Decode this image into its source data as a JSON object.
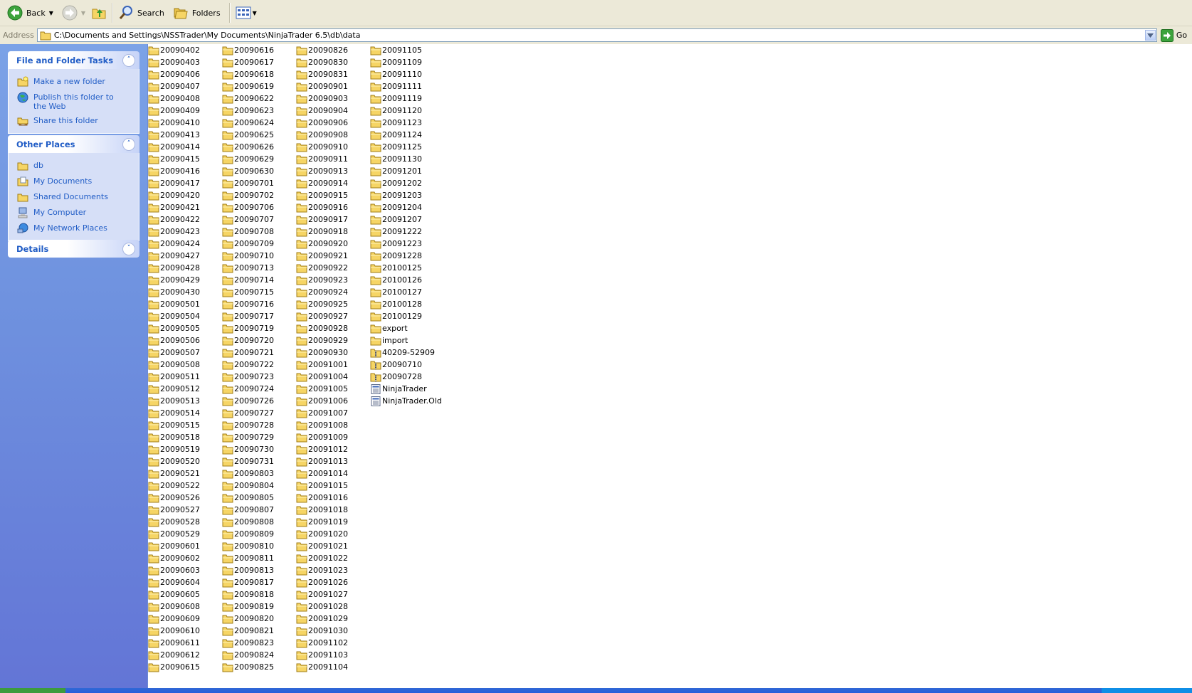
{
  "toolbar": {
    "back_label": "Back",
    "search_label": "Search",
    "folders_label": "Folders"
  },
  "address": {
    "label": "Address",
    "path": "C:\\Documents and Settings\\NSSTrader\\My Documents\\NinjaTrader 6.5\\db\\data",
    "go_label": "Go"
  },
  "tasks": {
    "file_folder": {
      "title": "File and Folder Tasks",
      "items": [
        {
          "label": "Make a new folder",
          "icon": "new-folder-icon"
        },
        {
          "label": "Publish this folder to the Web",
          "icon": "publish-web-icon"
        },
        {
          "label": "Share this folder",
          "icon": "share-folder-icon"
        }
      ]
    },
    "other_places": {
      "title": "Other Places",
      "items": [
        {
          "label": "db",
          "icon": "folder-icon"
        },
        {
          "label": "My Documents",
          "icon": "my-documents-icon"
        },
        {
          "label": "Shared Documents",
          "icon": "folder-icon"
        },
        {
          "label": "My Computer",
          "icon": "my-computer-icon"
        },
        {
          "label": "My Network Places",
          "icon": "network-places-icon"
        }
      ]
    },
    "details": {
      "title": "Details"
    }
  },
  "files": {
    "columns": [
      [
        {
          "name": "20090402",
          "icon": "folder"
        },
        {
          "name": "20090403",
          "icon": "folder"
        },
        {
          "name": "20090406",
          "icon": "folder"
        },
        {
          "name": "20090407",
          "icon": "folder"
        },
        {
          "name": "20090408",
          "icon": "folder"
        },
        {
          "name": "20090409",
          "icon": "folder"
        },
        {
          "name": "20090410",
          "icon": "folder"
        },
        {
          "name": "20090413",
          "icon": "folder"
        },
        {
          "name": "20090414",
          "icon": "folder"
        },
        {
          "name": "20090415",
          "icon": "folder"
        },
        {
          "name": "20090416",
          "icon": "folder"
        },
        {
          "name": "20090417",
          "icon": "folder"
        },
        {
          "name": "20090420",
          "icon": "folder"
        },
        {
          "name": "20090421",
          "icon": "folder"
        },
        {
          "name": "20090422",
          "icon": "folder"
        },
        {
          "name": "20090423",
          "icon": "folder"
        },
        {
          "name": "20090424",
          "icon": "folder"
        },
        {
          "name": "20090427",
          "icon": "folder"
        },
        {
          "name": "20090428",
          "icon": "folder"
        },
        {
          "name": "20090429",
          "icon": "folder"
        },
        {
          "name": "20090430",
          "icon": "folder"
        },
        {
          "name": "20090501",
          "icon": "folder"
        },
        {
          "name": "20090504",
          "icon": "folder"
        },
        {
          "name": "20090505",
          "icon": "folder"
        },
        {
          "name": "20090506",
          "icon": "folder"
        },
        {
          "name": "20090507",
          "icon": "folder"
        },
        {
          "name": "20090508",
          "icon": "folder"
        },
        {
          "name": "20090511",
          "icon": "folder"
        },
        {
          "name": "20090512",
          "icon": "folder"
        },
        {
          "name": "20090513",
          "icon": "folder"
        },
        {
          "name": "20090514",
          "icon": "folder"
        },
        {
          "name": "20090515",
          "icon": "folder"
        },
        {
          "name": "20090518",
          "icon": "folder"
        },
        {
          "name": "20090519",
          "icon": "folder"
        },
        {
          "name": "20090520",
          "icon": "folder"
        },
        {
          "name": "20090521",
          "icon": "folder"
        },
        {
          "name": "20090522",
          "icon": "folder"
        },
        {
          "name": "20090526",
          "icon": "folder"
        },
        {
          "name": "20090527",
          "icon": "folder"
        },
        {
          "name": "20090528",
          "icon": "folder"
        },
        {
          "name": "20090529",
          "icon": "folder"
        },
        {
          "name": "20090601",
          "icon": "folder"
        },
        {
          "name": "20090602",
          "icon": "folder"
        },
        {
          "name": "20090603",
          "icon": "folder"
        },
        {
          "name": "20090604",
          "icon": "folder"
        },
        {
          "name": "20090605",
          "icon": "folder"
        },
        {
          "name": "20090608",
          "icon": "folder"
        },
        {
          "name": "20090609",
          "icon": "folder"
        },
        {
          "name": "20090610",
          "icon": "folder"
        },
        {
          "name": "20090611",
          "icon": "folder"
        },
        {
          "name": "20090612",
          "icon": "folder"
        },
        {
          "name": "20090615",
          "icon": "folder"
        }
      ],
      [
        {
          "name": "20090616",
          "icon": "folder"
        },
        {
          "name": "20090617",
          "icon": "folder"
        },
        {
          "name": "20090618",
          "icon": "folder"
        },
        {
          "name": "20090619",
          "icon": "folder"
        },
        {
          "name": "20090622",
          "icon": "folder"
        },
        {
          "name": "20090623",
          "icon": "folder"
        },
        {
          "name": "20090624",
          "icon": "folder"
        },
        {
          "name": "20090625",
          "icon": "folder"
        },
        {
          "name": "20090626",
          "icon": "folder"
        },
        {
          "name": "20090629",
          "icon": "folder"
        },
        {
          "name": "20090630",
          "icon": "folder"
        },
        {
          "name": "20090701",
          "icon": "folder"
        },
        {
          "name": "20090702",
          "icon": "folder"
        },
        {
          "name": "20090706",
          "icon": "folder"
        },
        {
          "name": "20090707",
          "icon": "folder"
        },
        {
          "name": "20090708",
          "icon": "folder"
        },
        {
          "name": "20090709",
          "icon": "folder"
        },
        {
          "name": "20090710",
          "icon": "folder"
        },
        {
          "name": "20090713",
          "icon": "folder"
        },
        {
          "name": "20090714",
          "icon": "folder"
        },
        {
          "name": "20090715",
          "icon": "folder"
        },
        {
          "name": "20090716",
          "icon": "folder"
        },
        {
          "name": "20090717",
          "icon": "folder"
        },
        {
          "name": "20090719",
          "icon": "folder"
        },
        {
          "name": "20090720",
          "icon": "folder"
        },
        {
          "name": "20090721",
          "icon": "folder"
        },
        {
          "name": "20090722",
          "icon": "folder"
        },
        {
          "name": "20090723",
          "icon": "folder"
        },
        {
          "name": "20090724",
          "icon": "folder"
        },
        {
          "name": "20090726",
          "icon": "folder"
        },
        {
          "name": "20090727",
          "icon": "folder"
        },
        {
          "name": "20090728",
          "icon": "folder"
        },
        {
          "name": "20090729",
          "icon": "folder"
        },
        {
          "name": "20090730",
          "icon": "folder"
        },
        {
          "name": "20090731",
          "icon": "folder"
        },
        {
          "name": "20090803",
          "icon": "folder"
        },
        {
          "name": "20090804",
          "icon": "folder"
        },
        {
          "name": "20090805",
          "icon": "folder"
        },
        {
          "name": "20090807",
          "icon": "folder"
        },
        {
          "name": "20090808",
          "icon": "folder"
        },
        {
          "name": "20090809",
          "icon": "folder"
        },
        {
          "name": "20090810",
          "icon": "folder"
        },
        {
          "name": "20090811",
          "icon": "folder"
        },
        {
          "name": "20090813",
          "icon": "folder"
        },
        {
          "name": "20090817",
          "icon": "folder"
        },
        {
          "name": "20090818",
          "icon": "folder"
        },
        {
          "name": "20090819",
          "icon": "folder"
        },
        {
          "name": "20090820",
          "icon": "folder"
        },
        {
          "name": "20090821",
          "icon": "folder"
        },
        {
          "name": "20090823",
          "icon": "folder"
        },
        {
          "name": "20090824",
          "icon": "folder"
        },
        {
          "name": "20090825",
          "icon": "folder"
        }
      ],
      [
        {
          "name": "20090826",
          "icon": "folder"
        },
        {
          "name": "20090830",
          "icon": "folder"
        },
        {
          "name": "20090831",
          "icon": "folder"
        },
        {
          "name": "20090901",
          "icon": "folder"
        },
        {
          "name": "20090903",
          "icon": "folder"
        },
        {
          "name": "20090904",
          "icon": "folder"
        },
        {
          "name": "20090906",
          "icon": "folder"
        },
        {
          "name": "20090908",
          "icon": "folder"
        },
        {
          "name": "20090910",
          "icon": "folder"
        },
        {
          "name": "20090911",
          "icon": "folder"
        },
        {
          "name": "20090913",
          "icon": "folder"
        },
        {
          "name": "20090914",
          "icon": "folder"
        },
        {
          "name": "20090915",
          "icon": "folder"
        },
        {
          "name": "20090916",
          "icon": "folder"
        },
        {
          "name": "20090917",
          "icon": "folder"
        },
        {
          "name": "20090918",
          "icon": "folder"
        },
        {
          "name": "20090920",
          "icon": "folder"
        },
        {
          "name": "20090921",
          "icon": "folder"
        },
        {
          "name": "20090922",
          "icon": "folder"
        },
        {
          "name": "20090923",
          "icon": "folder"
        },
        {
          "name": "20090924",
          "icon": "folder"
        },
        {
          "name": "20090925",
          "icon": "folder"
        },
        {
          "name": "20090927",
          "icon": "folder"
        },
        {
          "name": "20090928",
          "icon": "folder"
        },
        {
          "name": "20090929",
          "icon": "folder"
        },
        {
          "name": "20090930",
          "icon": "folder"
        },
        {
          "name": "20091001",
          "icon": "folder"
        },
        {
          "name": "20091004",
          "icon": "folder"
        },
        {
          "name": "20091005",
          "icon": "folder"
        },
        {
          "name": "20091006",
          "icon": "folder"
        },
        {
          "name": "20091007",
          "icon": "folder"
        },
        {
          "name": "20091008",
          "icon": "folder"
        },
        {
          "name": "20091009",
          "icon": "folder"
        },
        {
          "name": "20091012",
          "icon": "folder"
        },
        {
          "name": "20091013",
          "icon": "folder"
        },
        {
          "name": "20091014",
          "icon": "folder"
        },
        {
          "name": "20091015",
          "icon": "folder"
        },
        {
          "name": "20091016",
          "icon": "folder"
        },
        {
          "name": "20091018",
          "icon": "folder"
        },
        {
          "name": "20091019",
          "icon": "folder"
        },
        {
          "name": "20091020",
          "icon": "folder"
        },
        {
          "name": "20091021",
          "icon": "folder"
        },
        {
          "name": "20091022",
          "icon": "folder"
        },
        {
          "name": "20091023",
          "icon": "folder"
        },
        {
          "name": "20091026",
          "icon": "folder"
        },
        {
          "name": "20091027",
          "icon": "folder"
        },
        {
          "name": "20091028",
          "icon": "folder"
        },
        {
          "name": "20091029",
          "icon": "folder"
        },
        {
          "name": "20091030",
          "icon": "folder"
        },
        {
          "name": "20091102",
          "icon": "folder"
        },
        {
          "name": "20091103",
          "icon": "folder"
        },
        {
          "name": "20091104",
          "icon": "folder"
        }
      ],
      [
        {
          "name": "20091105",
          "icon": "folder"
        },
        {
          "name": "20091109",
          "icon": "folder"
        },
        {
          "name": "20091110",
          "icon": "folder"
        },
        {
          "name": "20091111",
          "icon": "folder"
        },
        {
          "name": "20091119",
          "icon": "folder"
        },
        {
          "name": "20091120",
          "icon": "folder"
        },
        {
          "name": "20091123",
          "icon": "folder"
        },
        {
          "name": "20091124",
          "icon": "folder"
        },
        {
          "name": "20091125",
          "icon": "folder"
        },
        {
          "name": "20091130",
          "icon": "folder"
        },
        {
          "name": "20091201",
          "icon": "folder"
        },
        {
          "name": "20091202",
          "icon": "folder"
        },
        {
          "name": "20091203",
          "icon": "folder"
        },
        {
          "name": "20091204",
          "icon": "folder"
        },
        {
          "name": "20091207",
          "icon": "folder"
        },
        {
          "name": "20091222",
          "icon": "folder"
        },
        {
          "name": "20091223",
          "icon": "folder"
        },
        {
          "name": "20091228",
          "icon": "folder"
        },
        {
          "name": "20100125",
          "icon": "folder"
        },
        {
          "name": "20100126",
          "icon": "folder"
        },
        {
          "name": "20100127",
          "icon": "folder"
        },
        {
          "name": "20100128",
          "icon": "folder"
        },
        {
          "name": "20100129",
          "icon": "folder"
        },
        {
          "name": "export",
          "icon": "folder"
        },
        {
          "name": "import",
          "icon": "folder"
        },
        {
          "name": "40209-52909",
          "icon": "zip-folder"
        },
        {
          "name": "20090710",
          "icon": "zip-folder"
        },
        {
          "name": "20090728",
          "icon": "zip-folder"
        },
        {
          "name": "NinjaTrader",
          "icon": "db-file"
        },
        {
          "name": "NinjaTrader.Old",
          "icon": "db-file"
        }
      ]
    ]
  },
  "colors": {
    "toolbar_bg": "#ECE9D8",
    "taskpane_top": "#7BA2E7",
    "taskpane_bottom": "#6375D6",
    "link_blue": "#215DC6",
    "folder_yellow": "#F6D565"
  }
}
